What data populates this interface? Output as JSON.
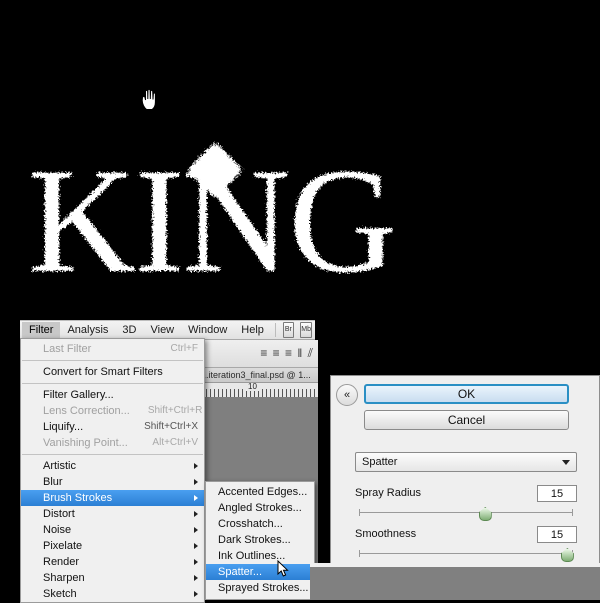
{
  "artwork": {
    "text": "KING",
    "letters_after_dot": "NG",
    "color": "#ffffff",
    "background": "#000000",
    "cursor": "hand-cursor"
  },
  "menubar": {
    "items": [
      {
        "label": "Filter",
        "active": true
      },
      {
        "label": "Analysis",
        "active": false
      },
      {
        "label": "3D",
        "active": false
      },
      {
        "label": "View",
        "active": false
      },
      {
        "label": "Window",
        "active": false
      },
      {
        "label": "Help",
        "active": false
      }
    ],
    "chips": [
      {
        "label": "Br"
      },
      {
        "label": "Mb"
      }
    ]
  },
  "document": {
    "tab_title": "...iteration3_final.psd @ 1...",
    "ruler_label": "10",
    "options_glyphs": "≡ ≡ ≡   ‖ ⫽"
  },
  "filter_menu": {
    "items": [
      {
        "label": "Last Filter",
        "accel": "Ctrl+F",
        "disabled": true,
        "submenu": false,
        "selected": false
      },
      {
        "separator": true
      },
      {
        "label": "Convert for Smart Filters",
        "accel": "",
        "disabled": false,
        "submenu": false,
        "selected": false
      },
      {
        "separator": true
      },
      {
        "label": "Filter Gallery...",
        "accel": "",
        "disabled": false,
        "submenu": false,
        "selected": false
      },
      {
        "label": "Lens Correction...",
        "accel": "Shift+Ctrl+R",
        "disabled": true,
        "submenu": false,
        "selected": false
      },
      {
        "label": "Liquify...",
        "accel": "Shift+Ctrl+X",
        "disabled": false,
        "submenu": false,
        "selected": false
      },
      {
        "label": "Vanishing Point...",
        "accel": "Alt+Ctrl+V",
        "disabled": true,
        "submenu": false,
        "selected": false
      },
      {
        "separator": true
      },
      {
        "label": "Artistic",
        "accel": "",
        "disabled": false,
        "submenu": true,
        "selected": false
      },
      {
        "label": "Blur",
        "accel": "",
        "disabled": false,
        "submenu": true,
        "selected": false
      },
      {
        "label": "Brush Strokes",
        "accel": "",
        "disabled": false,
        "submenu": true,
        "selected": true
      },
      {
        "label": "Distort",
        "accel": "",
        "disabled": false,
        "submenu": true,
        "selected": false
      },
      {
        "label": "Noise",
        "accel": "",
        "disabled": false,
        "submenu": true,
        "selected": false
      },
      {
        "label": "Pixelate",
        "accel": "",
        "disabled": false,
        "submenu": true,
        "selected": false
      },
      {
        "label": "Render",
        "accel": "",
        "disabled": false,
        "submenu": true,
        "selected": false
      },
      {
        "label": "Sharpen",
        "accel": "",
        "disabled": false,
        "submenu": true,
        "selected": false
      },
      {
        "label": "Sketch",
        "accel": "",
        "disabled": false,
        "submenu": true,
        "selected": false
      }
    ],
    "highlight_color": "#2b7fd4"
  },
  "brush_strokes_submenu": {
    "items": [
      {
        "label": "Accented Edges...",
        "selected": false
      },
      {
        "label": "Angled Strokes...",
        "selected": false
      },
      {
        "label": "Crosshatch...",
        "selected": false
      },
      {
        "label": "Dark Strokes...",
        "selected": false
      },
      {
        "label": "Ink Outlines...",
        "selected": false
      },
      {
        "label": "Spatter...",
        "selected": true
      },
      {
        "label": "Sprayed Strokes...",
        "selected": false
      }
    ]
  },
  "dialog": {
    "collapse_icon": "«",
    "ok_label": "OK",
    "cancel_label": "Cancel",
    "filter_select": "Spatter",
    "controls": [
      {
        "label": "Spray Radius",
        "value": "15",
        "thumb_pct": 58
      },
      {
        "label": "Smoothness",
        "value": "15",
        "thumb_pct": 95
      }
    ],
    "accent_color": "#2a8fc4"
  }
}
